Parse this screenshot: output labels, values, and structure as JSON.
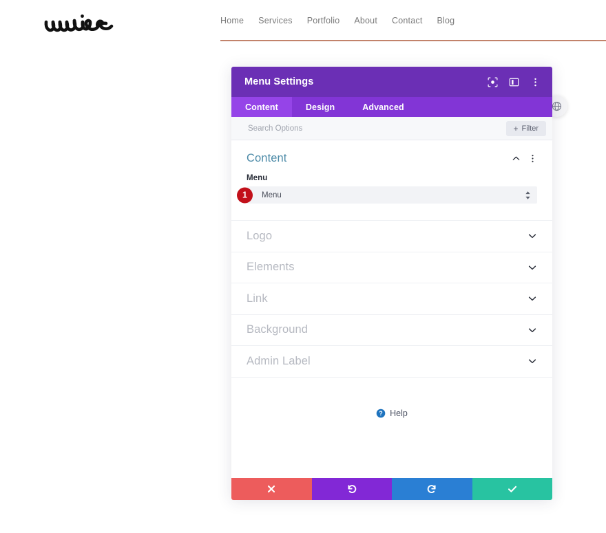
{
  "site": {
    "logo_text": "wire",
    "nav_items": [
      {
        "label": "Home"
      },
      {
        "label": "Services"
      },
      {
        "label": "Portfolio"
      },
      {
        "label": "About"
      },
      {
        "label": "Contact"
      },
      {
        "label": "Blog"
      }
    ],
    "nav_rule_color": "#c2836b"
  },
  "globe_badge": {
    "icon": "globe-icon"
  },
  "modal": {
    "title": "Menu Settings",
    "titlebar_color": "#6b2fb5",
    "tabbar_color": "#8235d6",
    "active_tab_color": "#9544e8",
    "titlebar_icons": [
      {
        "name": "focus-icon"
      },
      {
        "name": "layout-split-icon"
      },
      {
        "name": "more-vertical-icon"
      }
    ],
    "tabs": [
      {
        "label": "Content",
        "active": true
      },
      {
        "label": "Design",
        "active": false
      },
      {
        "label": "Advanced",
        "active": false
      }
    ],
    "search": {
      "value": "",
      "placeholder": "Search Options"
    },
    "filter_button": {
      "label": "Filter",
      "plus": "+"
    },
    "content_group": {
      "title": "Content",
      "collapse_icon": "chevron-up-icon",
      "more_icon": "more-vertical-icon",
      "field_label": "Menu",
      "select_value": "Menu",
      "step_badge": "1",
      "step_badge_color": "#c2101a"
    },
    "accordions": [
      {
        "label": "Logo"
      },
      {
        "label": "Elements"
      },
      {
        "label": "Link"
      },
      {
        "label": "Background"
      },
      {
        "label": "Admin Label"
      }
    ],
    "help": {
      "label": "Help",
      "icon": "question-circle-icon",
      "icon_color": "#1e73be"
    },
    "footer_buttons": [
      {
        "name": "cancel-button",
        "icon": "close-icon",
        "color": "#ed5c5c"
      },
      {
        "name": "undo-button",
        "icon": "undo-icon",
        "color": "#8228d6"
      },
      {
        "name": "redo-button",
        "icon": "redo-icon",
        "color": "#2a7fd4"
      },
      {
        "name": "save-button",
        "icon": "check-icon",
        "color": "#28c3a1"
      }
    ]
  }
}
